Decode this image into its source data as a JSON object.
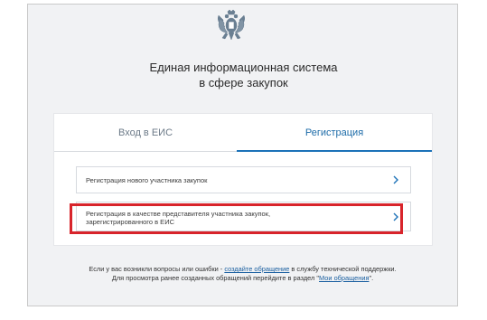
{
  "header": {
    "emblem_icon": "double-headed-eagle-emblem",
    "title_line1": "Единая информационная система",
    "title_line2": "в сфере закупок"
  },
  "tabs": [
    {
      "label": "Вход в ЕИС",
      "active": false
    },
    {
      "label": "Регистрация",
      "active": true
    }
  ],
  "options": [
    {
      "label_line1": "Регистрация нового участника закупок",
      "label_line2": "",
      "icon": "chevron-right-icon"
    },
    {
      "label_line1": "Регистрация в качестве представителя участника закупок,",
      "label_line2": "зарегистрированного в ЕИС",
      "icon": "chevron-right-icon",
      "highlighted": true
    }
  ],
  "footer": {
    "line1_prefix": "Если у вас возникли вопросы  или ошибки - ",
    "line1_link": "создайте обращение",
    "line1_suffix": " в службу технической поддержки.",
    "line2_prefix": "Для просмотра ранее созданных обращений перейдите в раздел \"",
    "line2_link": "Мои обращения",
    "line2_suffix": "\"."
  },
  "colors": {
    "accent": "#1c72b8",
    "highlight_border": "#d8242b",
    "page_background": "#f1f2f4"
  }
}
